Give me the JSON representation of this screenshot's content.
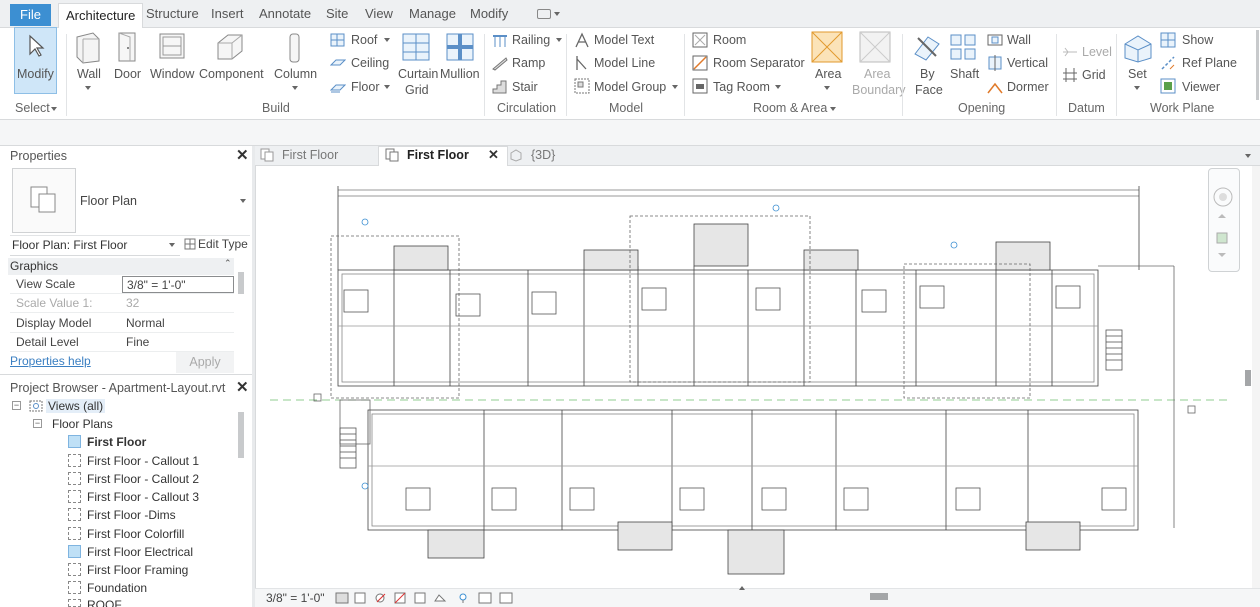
{
  "menu": {
    "file": "File",
    "tabs": [
      "Architecture",
      "Structure",
      "Insert",
      "Annotate",
      "Site",
      "View",
      "Manage",
      "Modify"
    ]
  },
  "ribbon": {
    "select": {
      "modify": "Modify",
      "panel": "Select"
    },
    "build": {
      "wall": "Wall",
      "door": "Door",
      "window": "Window",
      "component": "Component",
      "column": "Column",
      "roof": "Roof",
      "ceiling": "Ceiling",
      "floor": "Floor",
      "curtain_line1": "Curtain",
      "curtain_line2": "Grid",
      "mullion": "Mullion",
      "panel": "Build"
    },
    "circulation": {
      "railing": "Railing",
      "ramp": "Ramp",
      "stair": "Stair",
      "panel": "Circulation"
    },
    "model": {
      "text": "Model  Text",
      "line": "Model  Line",
      "group": "Model  Group",
      "panel": "Model"
    },
    "room_area": {
      "room": "Room",
      "separator": "Room  Separator",
      "tag_room": "Tag  Room",
      "area": "Area",
      "area_boundary_1": "Area",
      "area_boundary_2": "Boundary",
      "panel": "Room & Area"
    },
    "opening": {
      "by_face_1": "By",
      "by_face_2": "Face",
      "shaft": "Shaft",
      "wall": "Wall",
      "vertical": "Vertical",
      "dormer": "Dormer",
      "panel": "Opening"
    },
    "datum": {
      "level": "Level",
      "grid": "Grid",
      "panel": "Datum"
    },
    "work_plane": {
      "set": "Set",
      "show": "Show",
      "ref_plane": "Ref  Plane",
      "viewer": "Viewer",
      "panel": "Work Plane"
    }
  },
  "properties": {
    "title": "Properties",
    "type_name": "Floor Plan",
    "instance_select": "Floor Plan: First Floor",
    "edit_type": "Edit Type",
    "section": "Graphics",
    "rows": [
      {
        "k": "View Scale",
        "v": "3/8\" = 1'-0\""
      },
      {
        "k": "Scale Value    1:",
        "v": "32"
      },
      {
        "k": "Display Model",
        "v": "Normal"
      },
      {
        "k": "Detail Level",
        "v": "Fine"
      }
    ],
    "help": "Properties help",
    "apply": "Apply"
  },
  "browser": {
    "title": "Project Browser - Apartment-Layout.rvt",
    "root": "Views (all)",
    "group": "Floor Plans",
    "items": [
      "First Floor",
      "First Floor - Callout 1",
      "First Floor - Callout 2",
      "First Floor - Callout 3",
      "First Floor -Dims",
      "First Floor Colorfill",
      "First Floor Electrical",
      "First Floor Framing",
      "Foundation",
      "ROOF"
    ]
  },
  "view_tabs": [
    "First Floor",
    "First Floor",
    "{3D}"
  ],
  "status": {
    "scale": "3/8\" = 1'-0\""
  }
}
